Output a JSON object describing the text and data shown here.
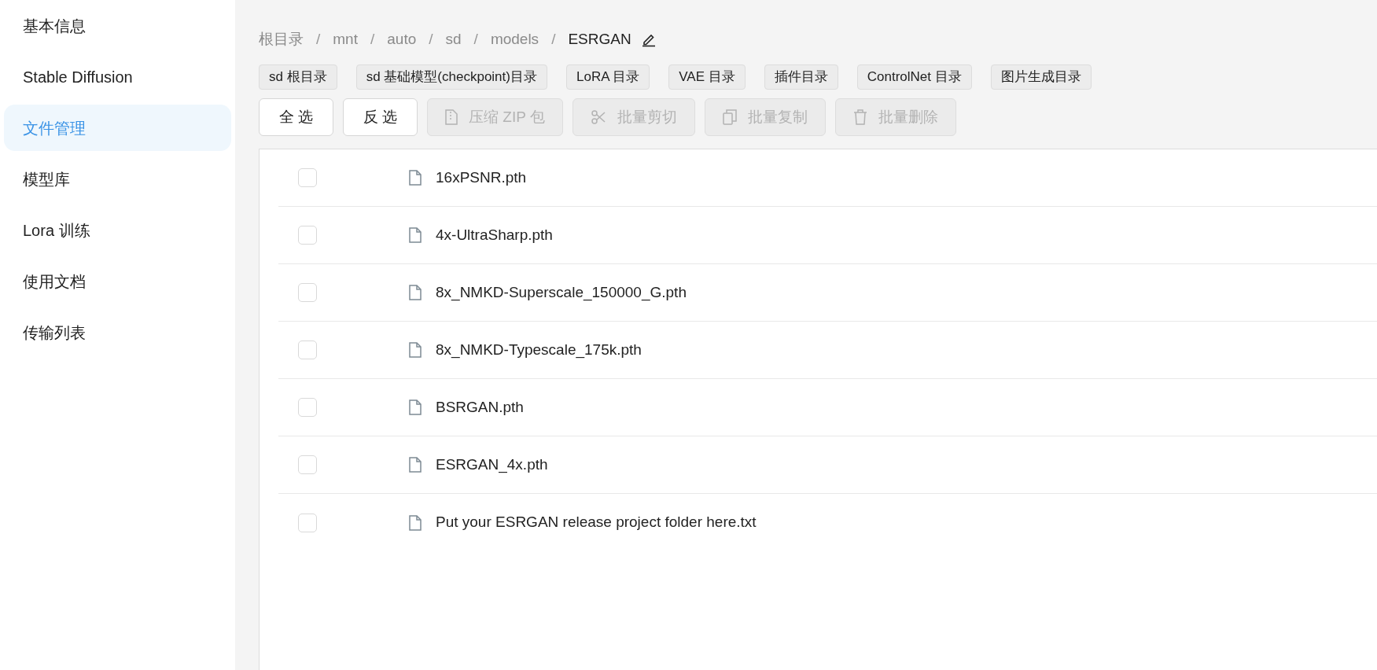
{
  "sidebar": {
    "items": [
      {
        "label": "基本信息",
        "selected": false
      },
      {
        "label": "Stable Diffusion",
        "selected": false
      },
      {
        "label": "文件管理",
        "selected": true
      },
      {
        "label": "模型库",
        "selected": false
      },
      {
        "label": "Lora 训练",
        "selected": false
      },
      {
        "label": "使用文档",
        "selected": false
      },
      {
        "label": "传输列表",
        "selected": false
      }
    ]
  },
  "breadcrumb": [
    "根目录",
    "mnt",
    "auto",
    "sd",
    "models",
    "ESRGAN"
  ],
  "breadcrumb_separator": "/",
  "shortcuts": [
    "sd 根目录",
    "sd 基础模型(checkpoint)目录",
    "LoRA 目录",
    "VAE 目录",
    "插件目录",
    "ControlNet 目录",
    "图片生成目录"
  ],
  "actions": [
    {
      "label": "全 选",
      "kind": "plain",
      "disabled": false
    },
    {
      "label": "反 选",
      "kind": "plain",
      "disabled": false
    },
    {
      "label": "压缩 ZIP 包",
      "kind": "zip",
      "disabled": true
    },
    {
      "label": "批量剪切",
      "kind": "cut",
      "disabled": true
    },
    {
      "label": "批量复制",
      "kind": "copy",
      "disabled": true
    },
    {
      "label": "批量删除",
      "kind": "delete",
      "disabled": true
    }
  ],
  "files": [
    {
      "name": "16xPSNR.pth",
      "checked": false
    },
    {
      "name": "4x-UltraSharp.pth",
      "checked": false
    },
    {
      "name": "8x_NMKD-Superscale_150000_G.pth",
      "checked": false
    },
    {
      "name": "8x_NMKD-Typescale_175k.pth",
      "checked": false
    },
    {
      "name": "BSRGAN.pth",
      "checked": false
    },
    {
      "name": "ESRGAN_4x.pth",
      "checked": false
    },
    {
      "name": "Put your ESRGAN release project folder here.txt",
      "checked": false
    }
  ]
}
